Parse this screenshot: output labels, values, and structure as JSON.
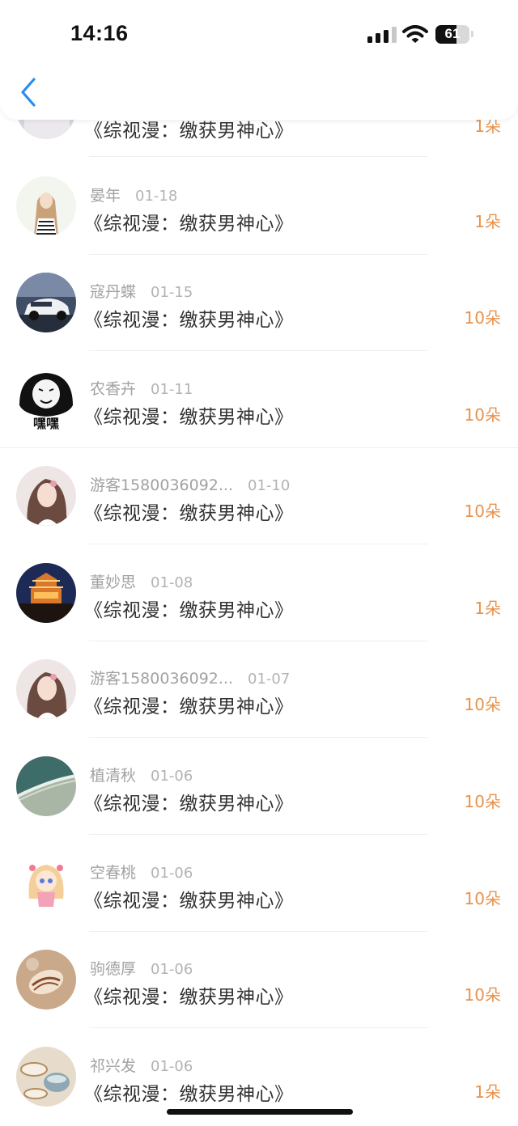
{
  "status_bar": {
    "time": "14:16",
    "battery_level": "61",
    "signal_bars_active": 3,
    "signal_bars_total": 4
  },
  "nav": {
    "back_icon": "chevron-left-icon",
    "accent_color": "#2a8cf0"
  },
  "colors": {
    "amount": "#e8924b",
    "username": "#a2a2a2",
    "title": "#333333"
  },
  "records": [
    {
      "user": "",
      "date": "",
      "title": "《综视漫：缴获男神心》",
      "amount": "1朵",
      "avatar": "avatar-cut"
    },
    {
      "user": "晏年",
      "date": "01-18",
      "title": "《综视漫：缴获男神心》",
      "amount": "1朵",
      "avatar": "girl-sketch"
    },
    {
      "user": "寇丹蝶",
      "date": "01-15",
      "title": "《综视漫：缴获男神心》",
      "amount": "10朵",
      "avatar": "white-car"
    },
    {
      "user": "农香卉",
      "date": "01-11",
      "title": "《综视漫：缴获男神心》",
      "amount": "10朵",
      "avatar": "meme-face",
      "avatar_text": "嘿嘿"
    },
    {
      "user": "游客1580036092...",
      "date": "01-10",
      "title": "《综视漫：缴获男神心》",
      "amount": "10朵",
      "avatar": "girl-portrait"
    },
    {
      "user": "董妙思",
      "date": "01-08",
      "title": "《综视漫：缴获男神心》",
      "amount": "1朵",
      "avatar": "night-tower"
    },
    {
      "user": "游客1580036092...",
      "date": "01-07",
      "title": "《综视漫：缴获男神心》",
      "amount": "10朵",
      "avatar": "girl-portrait"
    },
    {
      "user": "植清秋",
      "date": "01-06",
      "title": "《综视漫：缴获男神心》",
      "amount": "10朵",
      "avatar": "sea-wave"
    },
    {
      "user": "空春桃",
      "date": "01-06",
      "title": "《综视漫：缴获男神心》",
      "amount": "10朵",
      "avatar": "anime-girl"
    },
    {
      "user": "驹德厚",
      "date": "01-06",
      "title": "《综视漫：缴获男神心》",
      "amount": "10朵",
      "avatar": "seashell"
    },
    {
      "user": "祁兴发",
      "date": "01-06",
      "title": "《综视漫：缴获男神心》",
      "amount": "1朵",
      "avatar": "tea-set"
    }
  ]
}
